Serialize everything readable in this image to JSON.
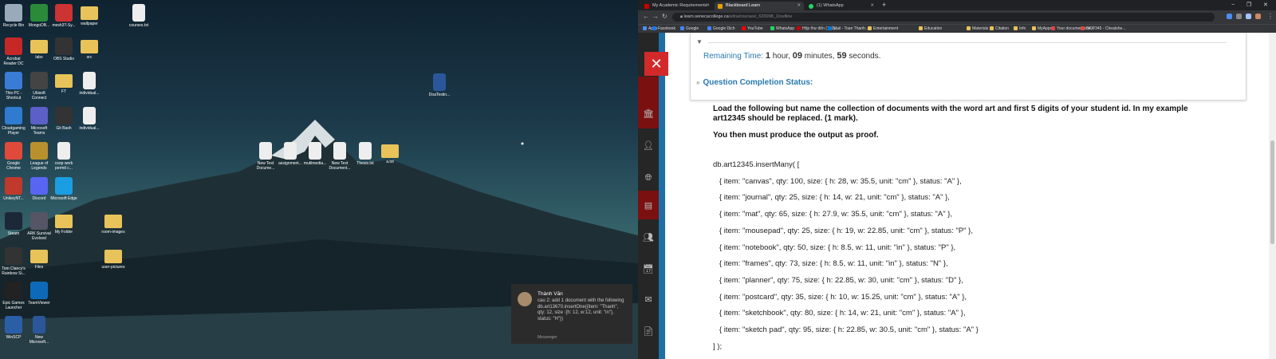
{
  "desktop": {
    "icons": [
      {
        "label": "Recycle Bin",
        "kind": "sys",
        "color": "#9ab"
      },
      {
        "label": "MongoDB...",
        "kind": "app",
        "color": "#2a8a3a"
      },
      {
        "label": "mesh3T-Sy...",
        "kind": "app",
        "color": "#c33"
      },
      {
        "label": "wallpaper",
        "kind": "folder",
        "color": "#e8c35a"
      },
      {
        "label": "courses.txt",
        "kind": "file",
        "color": "#eee"
      },
      {
        "label": "Acrobat Reader DC",
        "kind": "app",
        "color": "#c62828"
      },
      {
        "label": "labs",
        "kind": "folder",
        "color": "#e8c35a"
      },
      {
        "label": "OBS Studio",
        "kind": "app",
        "color": "#333"
      },
      {
        "label": "src",
        "kind": "folder",
        "color": "#e8c35a"
      },
      {
        "label": "This PC - Shortcut",
        "kind": "app",
        "color": "#3a7bd5"
      },
      {
        "label": "Ubisoft Connect",
        "kind": "app",
        "color": "#444"
      },
      {
        "label": "FT",
        "kind": "folder",
        "color": "#e8c35a"
      },
      {
        "label": "individual...",
        "kind": "file",
        "color": "#eee"
      },
      {
        "label": "Cloudgaming Player",
        "kind": "app",
        "color": "#2e7bcf"
      },
      {
        "label": "Microsoft Teams",
        "kind": "app",
        "color": "#5b5fc7"
      },
      {
        "label": "Git Bash",
        "kind": "app",
        "color": "#333"
      },
      {
        "label": "individual...",
        "kind": "file",
        "color": "#eee"
      },
      {
        "label": "Google Chrome",
        "kind": "app",
        "color": "#e04a3a"
      },
      {
        "label": "League of Legends",
        "kind": "app",
        "color": "#b8912e"
      },
      {
        "label": "coop work permit c...",
        "kind": "file",
        "color": "#eee"
      },
      {
        "label": "UnikeyNT...",
        "kind": "app",
        "color": "#c0392b"
      },
      {
        "label": "Discord",
        "kind": "app",
        "color": "#5865f2"
      },
      {
        "label": "Microsoft Edge",
        "kind": "app",
        "color": "#1b9de2"
      },
      {
        "label": "Steam",
        "kind": "app",
        "color": "#1b2838"
      },
      {
        "label": "ARK Survival Evolved",
        "kind": "app",
        "color": "#556"
      },
      {
        "label": "My Folder",
        "kind": "folder",
        "color": "#e8c35a"
      },
      {
        "label": "room-images",
        "kind": "folder",
        "color": "#e8c35a"
      },
      {
        "label": "Tom Clancy's Rainbow Si...",
        "kind": "app",
        "color": "#333"
      },
      {
        "label": "Files",
        "kind": "folder",
        "color": "#e8c35a"
      },
      {
        "label": "user-pictures",
        "kind": "folder",
        "color": "#e8c35a"
      },
      {
        "label": "Epic Games Launcher",
        "kind": "app",
        "color": "#222"
      },
      {
        "label": "TeamViewer",
        "kind": "app",
        "color": "#0e6ab8"
      },
      {
        "label": "WinSCP",
        "kind": "app",
        "color": "#2a5fa8"
      },
      {
        "label": "New Microsoft...",
        "kind": "file",
        "color": "#2b579a"
      },
      {
        "label": "DoaTestin...",
        "kind": "file",
        "color": "#2b579a"
      },
      {
        "label": "New Text Docume...",
        "kind": "file",
        "color": "#eee"
      },
      {
        "label": "assignment...",
        "kind": "file",
        "color": "#eee"
      },
      {
        "label": "mutilmedia...",
        "kind": "file",
        "color": "#eee"
      },
      {
        "label": "New Text Document...",
        "kind": "file",
        "color": "#eee"
      },
      {
        "label": "Thesis.txt",
        "kind": "file",
        "color": "#eee"
      },
      {
        "label": "a.txt",
        "kind": "folder",
        "color": "#e8c35a"
      }
    ],
    "notification": {
      "sender": "Thành Văn",
      "message": "cau 2: add 1 document with the following\ndb.art13670.insertOne({item: \"Thanh\", qty: 12, size :{h: 12, w:12, unit: \"in\"}, status: \"H\"})",
      "source": "Messenger"
    }
  },
  "browser": {
    "tabs": [
      {
        "title": "My Academic Requirements",
        "active": false,
        "color": "#cc0000"
      },
      {
        "title": "Blackboard Learn",
        "active": true,
        "color": "#e8a000"
      },
      {
        "title": "(1) WhatsApp",
        "active": false,
        "color": "#25d366"
      }
    ],
    "new_tab": "+",
    "window_controls": [
      "−",
      "❐",
      "✕"
    ],
    "url_host": "learn.senecacollege.ca",
    "url_path": "/ultra/courses/_620098_1/outline",
    "bookmarks": [
      "Apps",
      "Facebook",
      "Google",
      "Google Dịch",
      "YouTube",
      "WhatsApp",
      "Hộp thư đến (192)...",
      "Mail - Toan Thanh...",
      "Entertainment",
      "Education",
      "Materials",
      "Citation",
      "Info",
      "MyApps",
      "Your document che...",
      "OOP345 - Cheatshe..."
    ],
    "remaining_time": {
      "label": "Remaining Time:",
      "hours": "1",
      "hour_unit": "hour,",
      "minutes": "09",
      "minute_unit": "minutes,",
      "seconds": "59",
      "second_unit": "seconds."
    },
    "completion_status": "Question Completion Status:",
    "instruction": "Load the following but name the collection of documents with the word art and first 5 digits of your student id. In my example art12345 should be replaced. (1 mark).",
    "instruction2": "You then must produce the output as proof.",
    "code": [
      "db.art12345.insertMany( [",
      "   { item: \"canvas\", qty: 100, size: { h: 28, w: 35.5, unit: \"cm\" }, status: \"A\" },",
      "   { item: \"journal\", qty: 25, size: { h: 14, w: 21, unit: \"cm\" }, status: \"A\" },",
      "   { item: \"mat\", qty: 65, size: { h: 27.9, w: 35.5, unit: \"cm\" }, status: \"A\" },",
      "   { item: \"mousepad\", qty: 25, size: { h: 19, w: 22.85, unit: \"cm\" }, status: \"P\" },",
      "   { item: \"notebook\", qty: 50, size: { h: 8.5, w: 11, unit: \"in\" }, status: \"P\" },",
      "   { item: \"frames\", qty: 73, size: { h: 8.5, w: 11, unit: \"in\" }, status: \"N\" },",
      "   { item: \"planner\", qty: 75, size: { h: 22.85, w: 30, unit: \"cm\" }, status: \"D\" },",
      "   { item: \"postcard\", qty: 35, size: { h: 10, w: 15.25, unit: \"cm\" }, status: \"A\" },",
      "   { item: \"sketchbook\", qty: 80, size: { h: 14, w: 21, unit: \"cm\" }, status: \"A\" },",
      "   { item: \"sketch pad\", qty: 95, size: { h: 22.85, w: 30.5, unit: \"cm\" }, status: \"A\" }",
      "] );"
    ]
  }
}
